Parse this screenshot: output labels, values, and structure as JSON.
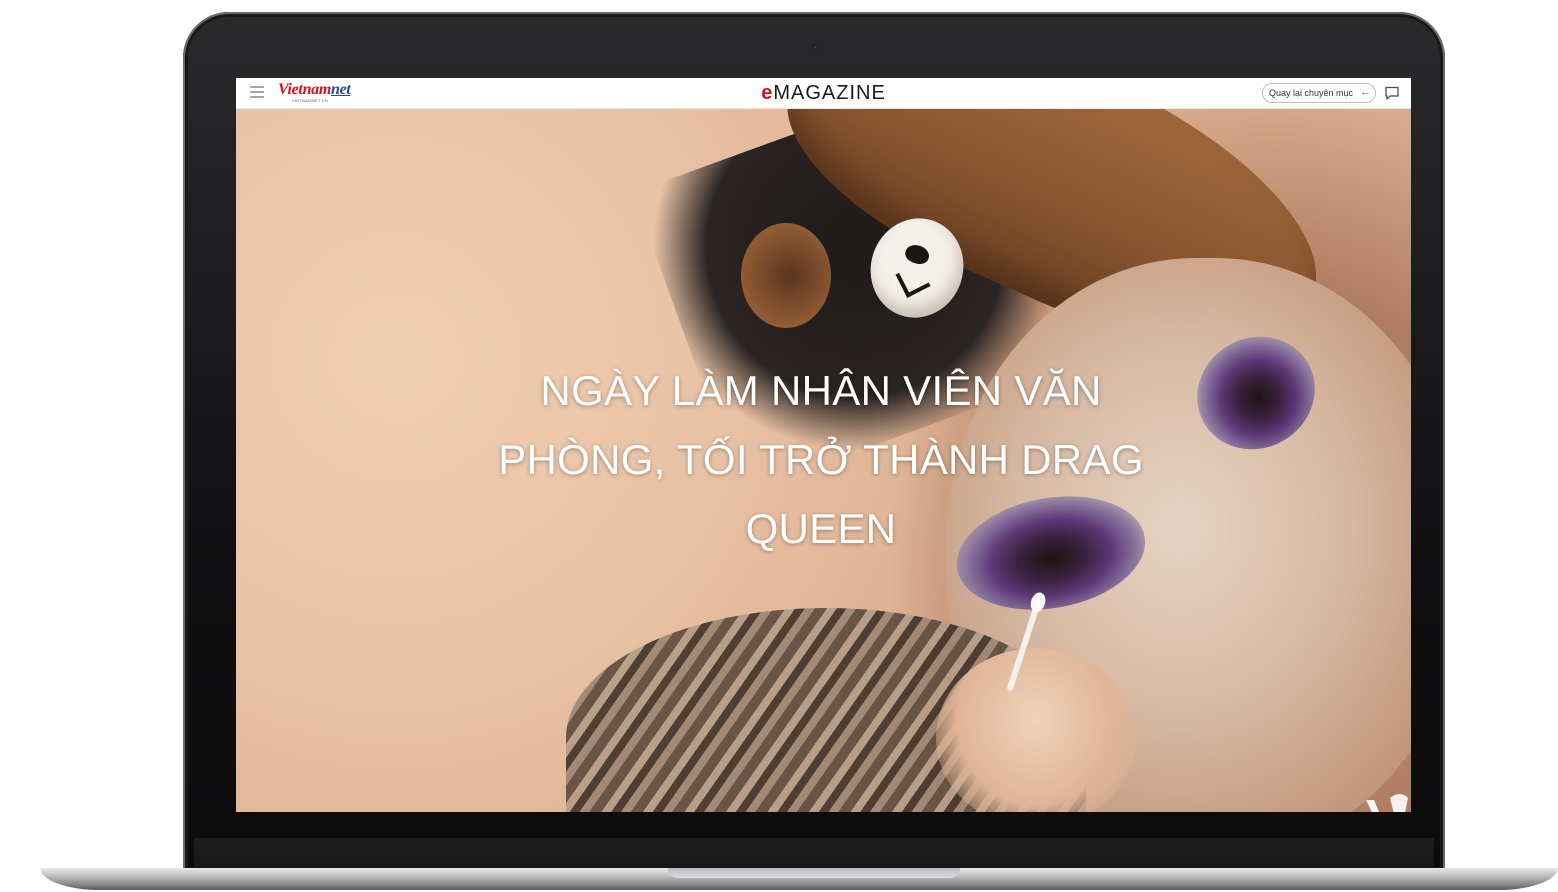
{
  "header": {
    "menu_icon": "hamburger-menu-icon",
    "logo": {
      "main": "Vietnam",
      "net": "net",
      "sub": "VIETNAMNET.VN"
    },
    "brand": {
      "e": "e",
      "rest": "MAGAZINE"
    },
    "back_label": "Quay lại chuyên mục",
    "back_icon": "arrow-left-icon",
    "comment_icon": "comment-icon"
  },
  "hero": {
    "title": "NGÀY LÀM NHÂN VIÊN VĂN PHÒNG, TỐI TRỞ THÀNH DRAG QUEEN",
    "image": "portrait-drag-makeup",
    "watermark": "vietnamnet-v-logo"
  },
  "colors": {
    "brand_red": "#d4111c",
    "brand_blue": "#1e4b9a",
    "title": "#ffffff"
  }
}
